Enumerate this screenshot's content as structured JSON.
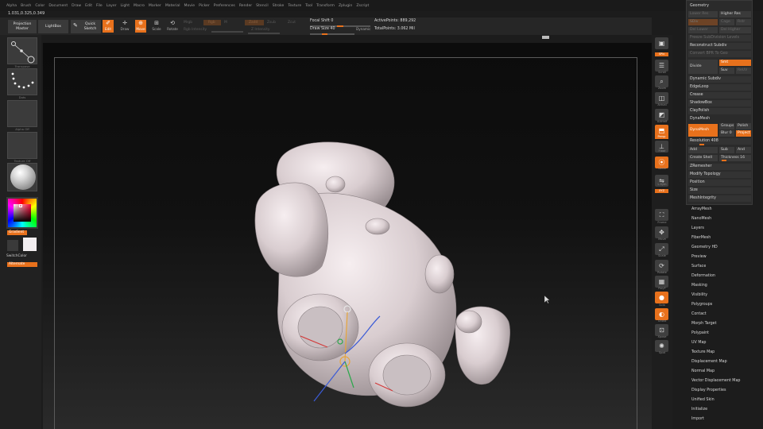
{
  "menu": [
    "Alpha",
    "Brush",
    "Color",
    "Document",
    "Draw",
    "Edit",
    "File",
    "Layer",
    "Light",
    "Macro",
    "Marker",
    "Material",
    "Movie",
    "Picker",
    "Preferences",
    "Render",
    "Stencil",
    "Stroke",
    "Texture",
    "Tool",
    "Transform",
    "Zplugin",
    "Zscript"
  ],
  "coords": "1.031,0.325,0.349",
  "toolbar": {
    "projection_master": "Projection Master",
    "lightbox": "LightBox",
    "quick_sketch": "Quick Sketch",
    "edit": "Edit",
    "draw": "Draw",
    "move": "Move",
    "scale": "Scale",
    "rotate": "Rotate",
    "faded_mrgb": "Mrgb",
    "faded_rgb": "Rgb",
    "faded_m": "M",
    "faded_rgb_intensity": "Rgb Intensity",
    "faded_zadd": "Zadd",
    "faded_zsub": "Zsub",
    "faded_zcut": "Zcut",
    "faded_z_intensity": "Z Intensity",
    "focal_shift": "Focal Shift 0",
    "draw_size": "Draw Size 40",
    "dynamic": "Dynamic",
    "active_points": "ActivePoints: 889,292",
    "total_points": "TotalPoints: 3.062 Mil"
  },
  "left": {
    "transpose_caption": "Transpose",
    "dots_caption": "Dots",
    "alpha_caption": "Alpha Off",
    "texture_caption": "Texture Off",
    "gradient": "Gradient",
    "switchcolor": "SwitchColor",
    "alternate": "Alternate"
  },
  "right": {
    "spix": "SPix",
    "scroll": "Scroll",
    "zoom": "Zoom",
    "actual": "Actual",
    "aahalf": "AAHalf",
    "persp": "Persp",
    "floor": "Floor",
    "local": "Local",
    "lsym": "L.Sym",
    "xyz": "XYZ",
    "frame": "Frame",
    "move": "Move",
    "scale": "Scale",
    "rotate": "Rotate",
    "polyf": "PolyF",
    "solo": "Solo",
    "ghost": "Ghost",
    "xpose": "Xpose",
    "spotlight": "Spot"
  },
  "palette": {
    "title": "Geometry",
    "lower_res": "Lower Res",
    "higher_res": "Higher Res",
    "sdiv": "SDiv",
    "cage": "Cage",
    "rstr": "Rstr",
    "del_lower": "Del Lower",
    "del_higher": "Del Higher",
    "freeze_subdivision": "Freeze SubDivision Levels",
    "reconstruct_subdiv": "Reconstruct Subdiv",
    "convert_bpr": "Convert BPR To Geo",
    "divide": "Divide",
    "smt": "Smt",
    "suv": "Suv",
    "reuv": "ReUV",
    "dynamic_subdiv": "Dynamic Subdiv",
    "edgeloop": "EdgeLoop",
    "crease": "Crease",
    "shadowbox": "ShadowBox",
    "claypolish": "ClayPolish",
    "dynamesh": "DynaMesh",
    "dynamesh_btn": "DynaMesh",
    "groups": "Groups",
    "polish": "Polish",
    "blur": "Blur 0",
    "project": "Project",
    "resolution": "Resolution 408",
    "add": "Add",
    "sub": "Sub",
    "and": "And",
    "create_shell": "Create Shell",
    "thickness": "Thickness 16",
    "zremesher": "ZRemesher",
    "modify_topology": "Modify Topology",
    "position": "Position",
    "size": "Size",
    "meshintegrity": "MeshIntegrity"
  },
  "subpalettes": [
    "ArrayMesh",
    "NanoMesh",
    "Layers",
    "FiberMesh",
    "Geometry HD",
    "Preview",
    "Surface",
    "Deformation",
    "Masking",
    "Visibility",
    "Polygroups",
    "Contact",
    "Morph Target",
    "Polypaint",
    "UV Map",
    "Texture Map",
    "Displacement Map",
    "Normal Map",
    "Vector Displacement Map",
    "Display Properties",
    "Unified Skin",
    "Initialize",
    "Import"
  ],
  "colors": {
    "accent": "#e8711c",
    "panel": "#2b2b2b",
    "model": "#e9dfe2"
  }
}
